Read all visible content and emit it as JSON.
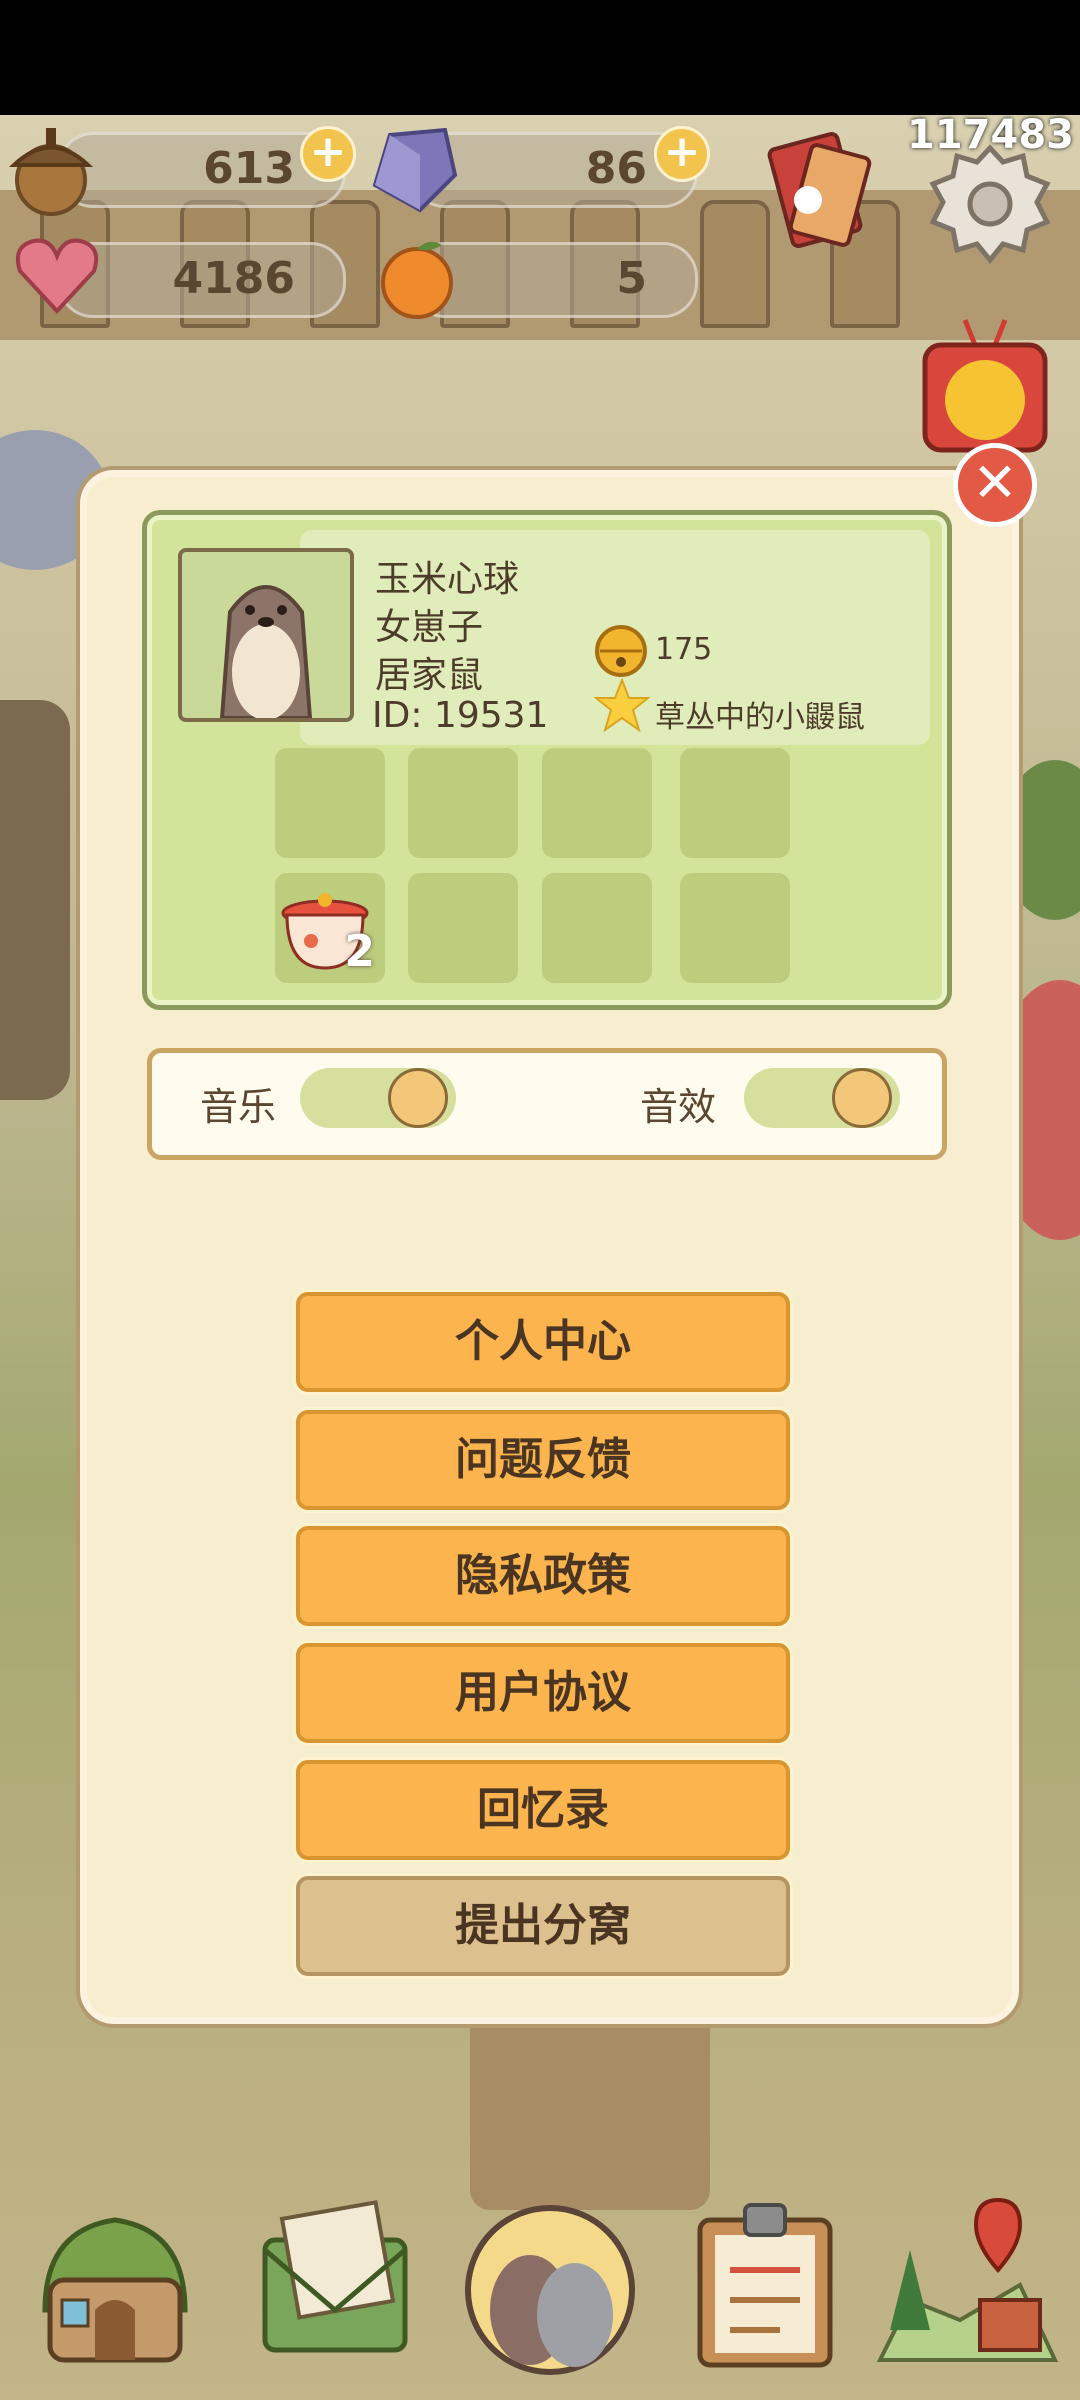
{
  "top_counter": "117483",
  "resources": [
    {
      "name": "acorn-icon",
      "value": "613"
    },
    {
      "name": "crystal-icon",
      "value": "86"
    },
    {
      "name": "heart-gem-icon",
      "value": "4186"
    },
    {
      "name": "orange-icon",
      "value": "5"
    }
  ],
  "profile": {
    "nickname": "玉米心球",
    "gender": "女崽子",
    "species": "居家鼠",
    "id": "ID: 19531",
    "bell_count": "175",
    "title": "草丛中的小鼹鼠",
    "slot_item_count": "2"
  },
  "settings": {
    "music_label": "音乐",
    "sfx_label": "音效"
  },
  "menu": {
    "personal_center": "个人中心",
    "feedback": "问题反馈",
    "privacy": "隐私政策",
    "user_agreement": "用户协议",
    "memories": "回忆录",
    "leave_den": "提出分窝"
  },
  "colors": {
    "button": "#fcb54e",
    "button_alt": "#dcc08d",
    "panel": "#f7edcf",
    "profile_bg": "#d2e39a",
    "close": "#e25a45"
  }
}
